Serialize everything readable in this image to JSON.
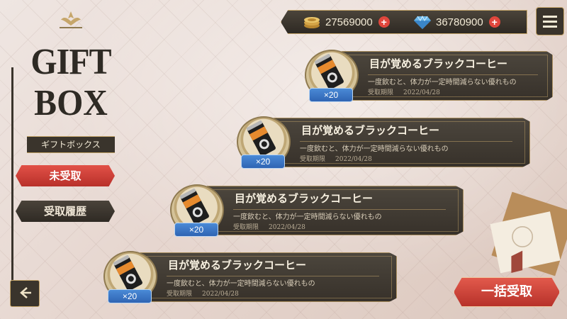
{
  "logo": {
    "line1": "GIFT",
    "line2": "BOX",
    "subtitle": "ギフトボックス"
  },
  "tabs": [
    {
      "label": "未受取",
      "active": true
    },
    {
      "label": "受取履歴",
      "active": false
    }
  ],
  "currency": {
    "coins": "27569000",
    "gems": "36780900"
  },
  "items": [
    {
      "title": "目が覚めるブラックコーヒー",
      "description": "一度飲むと、体力が一定時間減らない優れもの",
      "date_label": "受取期限",
      "date": "2022/04/28",
      "count": "×20"
    },
    {
      "title": "目が覚めるブラックコーヒー",
      "description": "一度飲むと、体力が一定時間減らない優れもの",
      "date_label": "受取期限",
      "date": "2022/04/28",
      "count": "×20"
    },
    {
      "title": "目が覚めるブラックコーヒー",
      "description": "一度飲むと、体力が一定時間減らない優れもの",
      "date_label": "受取期限",
      "date": "2022/04/28",
      "count": "×20"
    },
    {
      "title": "目が覚めるブラックコーヒー",
      "description": "一度飲むと、体力が一定時間減らない優れもの",
      "date_label": "受取期限",
      "date": "2022/04/28",
      "count": "×20"
    }
  ],
  "claim_all_label": "一括受取",
  "icons": {
    "back": "back-arrow-icon",
    "menu": "hamburger-menu-icon",
    "coins": "coin-stack-icon",
    "gems": "diamond-icon",
    "plus": "plus-icon",
    "item": "coffee-can-icon"
  },
  "colors": {
    "active_tab": "#d9443b",
    "panel_dark": "#3a342c",
    "gold_trim": "#c6a66a",
    "count_badge": "#3f7ccc"
  }
}
